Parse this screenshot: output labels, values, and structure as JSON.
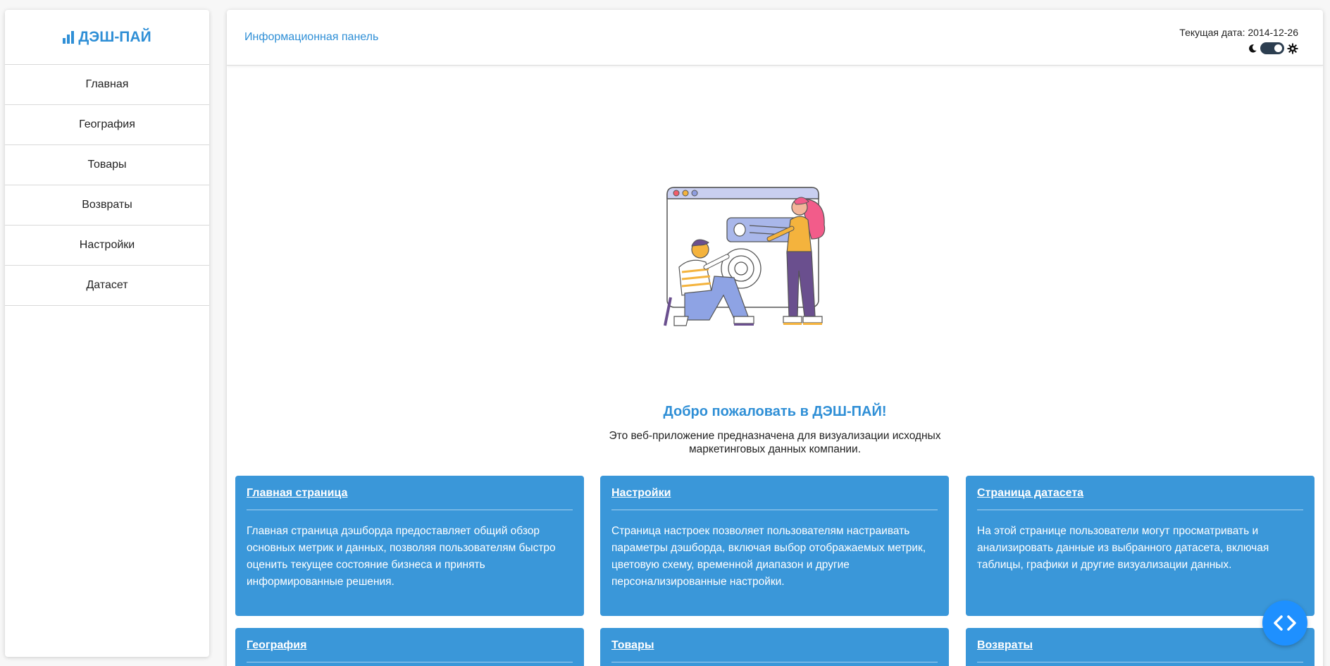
{
  "sidebar": {
    "brand": "ДЭШ-ПАЙ",
    "items": [
      {
        "label": "Главная"
      },
      {
        "label": "География"
      },
      {
        "label": "Товары"
      },
      {
        "label": "Возвраты"
      },
      {
        "label": "Настройки"
      },
      {
        "label": "Датасет"
      }
    ]
  },
  "header": {
    "title": "Информационная панель",
    "date_label": "Текущая дата: 2014-12-26"
  },
  "welcome": {
    "title": "Добро пожаловать в ДЭШ-ПАЙ!",
    "text": "Это веб-приложение предназначена для визуализации исходных маркетинговых данных компании."
  },
  "cards": [
    {
      "title": "Главная страница",
      "text": "Главная страница дэшборда предоставляет общий обзор основных метрик и данных, позволяя пользователям быстро оценить текущее состояние бизнеса и принять информированные решения."
    },
    {
      "title": "Настройки",
      "text": "Страница настроек позволяет пользователям настраивать параметры дэшборда, включая выбор отображаемых метрик, цветовую схему, временной диапазон и другие персонализированные настройки."
    },
    {
      "title": "Страница датасета",
      "text": "На этой странице пользователи могут просматривать и анализировать данные из выбранного датасета, включая таблицы, графики и другие визуализации данных."
    },
    {
      "title": "География",
      "text": ""
    },
    {
      "title": "Товары",
      "text": ""
    },
    {
      "title": "Возвраты",
      "text": ""
    }
  ],
  "theme": {
    "accent": "#2f8fd6",
    "card_bg": "#3a97d9",
    "fab": "#1e90ff",
    "dark_mode": true
  },
  "icons": [
    "bar-chart-icon",
    "moon-icon",
    "gear-icon",
    "code-icon"
  ]
}
